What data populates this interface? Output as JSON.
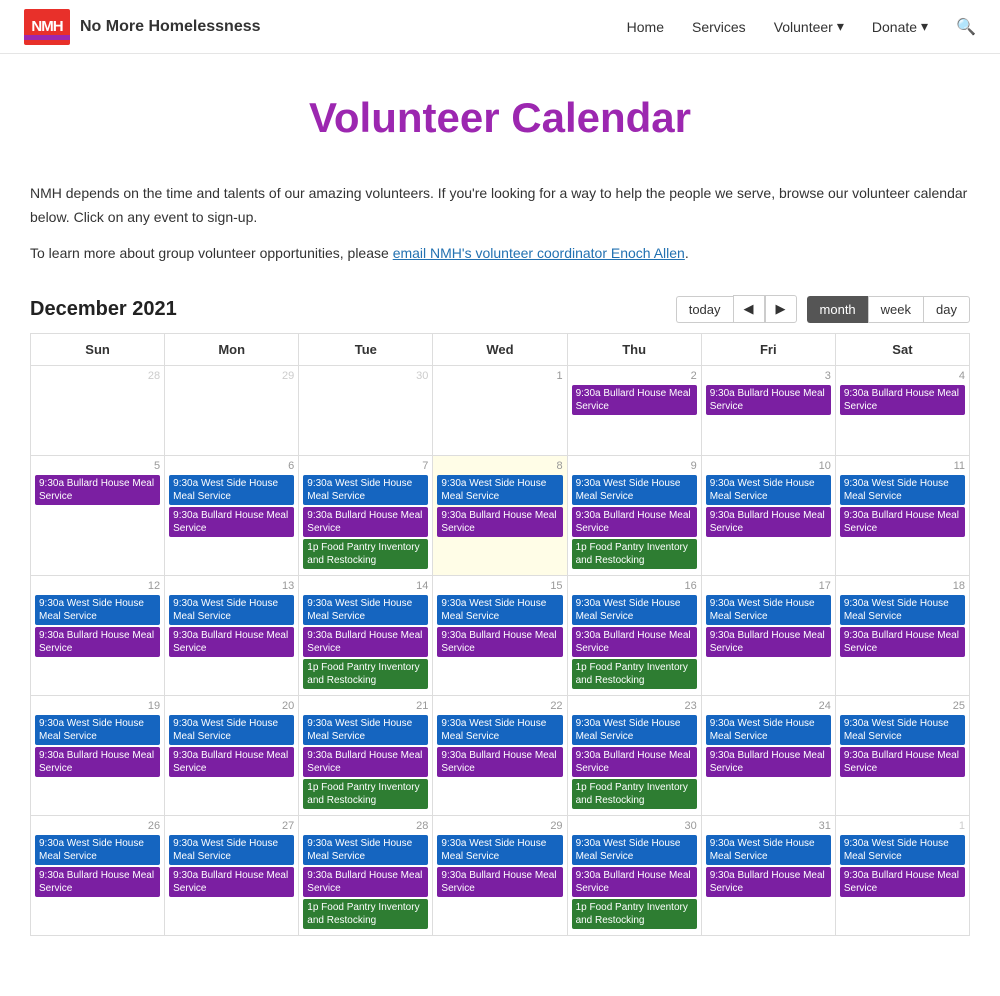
{
  "brand": {
    "name": "No More Homelessness",
    "logo_text": "NMH"
  },
  "nav": {
    "home": "Home",
    "services": "Services",
    "volunteer": "Volunteer",
    "donate": "Donate"
  },
  "page": {
    "title": "Volunteer Calendar",
    "description1": "NMH depends on the time and talents of our amazing volunteers. If you're looking for a way to help the people we serve, browse our volunteer calendar below. Click on any event to sign-up.",
    "description2": "To learn more about group volunteer opportunities, please",
    "link_text": "email NMH's volunteer coordinator Enoch Allen",
    "description2_end": "."
  },
  "calendar": {
    "month_title": "December 2021",
    "today_btn": "today",
    "view_month": "month",
    "view_week": "week",
    "view_day": "day",
    "days_of_week": [
      "Sun",
      "Mon",
      "Tue",
      "Wed",
      "Thu",
      "Fri",
      "Sat"
    ],
    "events": {
      "bullard": "9:30a Bullard House Meal Service",
      "westside": "9:30a West Side House Meal Service",
      "food_pantry": "1p Food Pantry Inventory and Restocking"
    }
  }
}
